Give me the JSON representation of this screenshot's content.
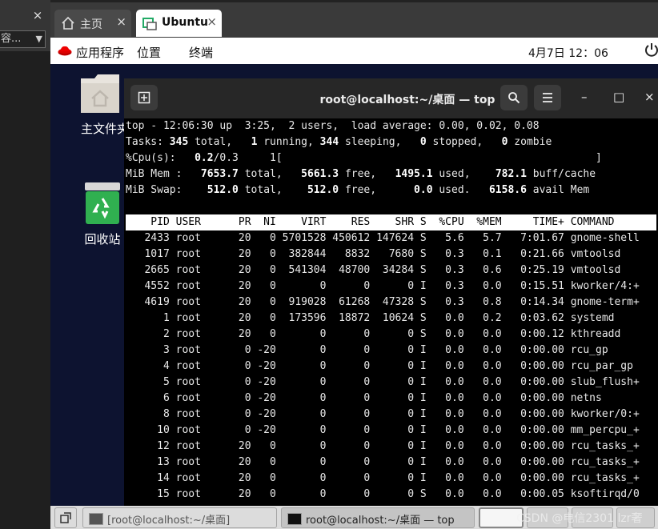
{
  "left_panel": {
    "search_text": "容...",
    "close": "×"
  },
  "browser_tabs": [
    {
      "label": "主页",
      "icon": "home-icon",
      "close": "×"
    },
    {
      "label": "Ubuntu",
      "icon": "vm-icon",
      "close": "×"
    }
  ],
  "gnome_bar": {
    "menu_apps": "应用程序",
    "menu_places": "位置",
    "menu_terminal": "终端",
    "clock": "4月7日  12：06",
    "power_icon": "power-icon"
  },
  "desktop": {
    "icons": [
      {
        "label": "主文件夹",
        "icon": "home-folder-icon"
      },
      {
        "label": "回收站",
        "icon": "trash-icon"
      }
    ]
  },
  "terminal": {
    "title": "root@localhost:~/桌面 — top",
    "buttons": {
      "new_tab": "new-tab-icon",
      "search": "search-icon",
      "menu": "hamburger-menu-icon",
      "minimize": "–",
      "maximize": "□",
      "close": "×"
    },
    "summary": {
      "line1": "top - 12:06:30 up  3:25,  2 users,  load average: 0.00, 0.02, 0.08",
      "tasks_label": "Tasks: ",
      "tasks_total": "345",
      "tasks_total_l": " total,   ",
      "tasks_running": "1",
      "tasks_running_l": " running, ",
      "tasks_sleeping": "344",
      "tasks_sleeping_l": " sleeping,   ",
      "tasks_stopped": "0",
      "tasks_stopped_l": " stopped,   ",
      "tasks_zombie": "0",
      "tasks_zombie_l": " zombie",
      "cpu_label": "%Cpu(s):   ",
      "cpu_val": "0.2",
      "cpu_rest": "/0.3     1[                                                  ]",
      "mem_label": "MiB Mem :   ",
      "mem_total": "7653.7",
      "mem_total_l": " total,   ",
      "mem_free": "5661.3",
      "mem_free_l": " free,   ",
      "mem_used": "1495.1",
      "mem_used_l": " used,    ",
      "mem_buff": "782.1",
      "mem_buff_l": " buff/cache",
      "swap_label": "MiB Swap:    ",
      "swap_total": "512.0",
      "swap_total_l": " total,    ",
      "swap_free": "512.0",
      "swap_free_l": " free,      ",
      "swap_used": "0.0",
      "swap_used_l": " used.   ",
      "swap_avail": "6158.6",
      "swap_avail_l": " avail Mem"
    },
    "header": "    PID USER      PR  NI    VIRT    RES    SHR S  %CPU  %MEM     TIME+ COMMAND        ",
    "processes": [
      "   2433 root      20   0 5701528 450612 147624 S   5.6   5.7   7:01.67 gnome-shell",
      "   1017 root      20   0  382844   8832   7680 S   0.3   0.1   0:21.66 vmtoolsd",
      "   2665 root      20   0  541304  48700  34284 S   0.3   0.6   0:25.19 vmtoolsd",
      "   4552 root      20   0       0      0      0 I   0.3   0.0   0:15.51 kworker/4:+",
      "   4619 root      20   0  919028  61268  47328 S   0.3   0.8   0:14.34 gnome-term+",
      "      1 root      20   0  173596  18872  10624 S   0.0   0.2   0:03.62 systemd",
      "      2 root      20   0       0      0      0 S   0.0   0.0   0:00.12 kthreadd",
      "      3 root       0 -20       0      0      0 I   0.0   0.0   0:00.00 rcu_gp",
      "      4 root       0 -20       0      0      0 I   0.0   0.0   0:00.00 rcu_par_gp",
      "      5 root       0 -20       0      0      0 I   0.0   0.0   0:00.00 slub_flush+",
      "      6 root       0 -20       0      0      0 I   0.0   0.0   0:00.00 netns",
      "      8 root       0 -20       0      0      0 I   0.0   0.0   0:00.00 kworker/0:+",
      "     10 root       0 -20       0      0      0 I   0.0   0.0   0:00.00 mm_percpu_+",
      "     12 root      20   0       0      0      0 I   0.0   0.0   0:00.00 rcu_tasks_+",
      "     13 root      20   0       0      0      0 I   0.0   0.0   0:00.00 rcu_tasks_+",
      "     14 root      20   0       0      0      0 I   0.0   0.0   0:00.00 rcu_tasks_+",
      "     15 root      20   0       0      0      0 S   0.0   0.0   0:00.05 ksoftirqd/0"
    ]
  },
  "taskbar": {
    "items": [
      {
        "label": "[root@localhost:~/桌面]",
        "icon": "terminal-icon"
      },
      {
        "label": "root@localhost:~/桌面 — top",
        "icon": "terminal-icon"
      }
    ],
    "watermark": "CSDN @电信2301   lzr奢"
  }
}
